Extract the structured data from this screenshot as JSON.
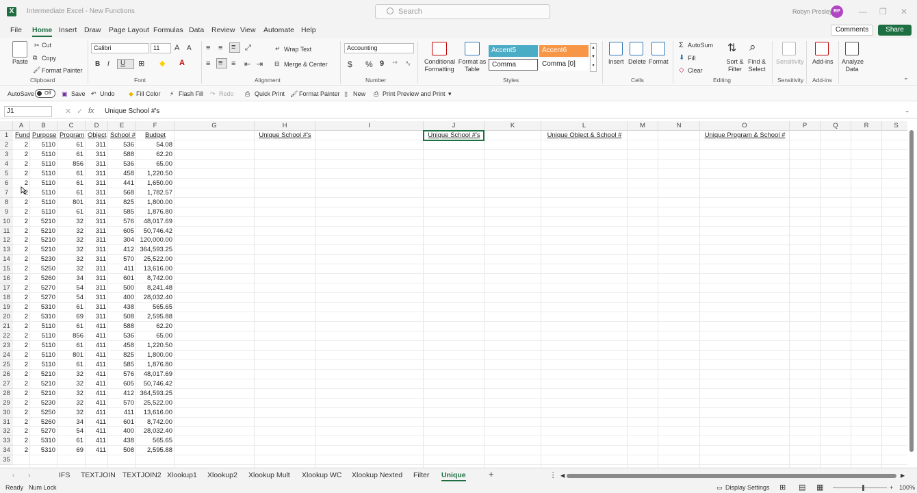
{
  "window": {
    "title": "Intermediate Excel - New Functions",
    "search_placeholder": "Search",
    "user_name": "Robyn Presley",
    "user_initials": "RP"
  },
  "menu": {
    "tabs": [
      "File",
      "Home",
      "Insert",
      "Draw",
      "Page Layout",
      "Formulas",
      "Data",
      "Review",
      "View",
      "Automate",
      "Help"
    ],
    "active": "Home",
    "comments_label": "Comments",
    "share_label": "Share"
  },
  "ribbon": {
    "clipboard": {
      "paste": "Paste",
      "cut": "Cut",
      "copy": "Copy",
      "format_painter": "Format Painter",
      "label": "Clipboard"
    },
    "font": {
      "name": "Calibri",
      "size": "11",
      "bold": "B",
      "italic": "I",
      "underline": "U",
      "label": "Font"
    },
    "alignment": {
      "wrap_text": "Wrap Text",
      "merge_center": "Merge & Center",
      "label": "Alignment"
    },
    "number": {
      "format": "Accounting",
      "currency": "$",
      "percent": "%",
      "comma": "9",
      "label": "Number"
    },
    "styles": {
      "conditional_formatting": "Conditional Formatting",
      "format_as_table": "Format as Table",
      "accent5": "Accent5",
      "accent6": "Accent6",
      "comma": "Comma",
      "comma0": "Comma [0]",
      "label": "Styles",
      "accent5_color": "#4bacc6",
      "accent6_color": "#f79646"
    },
    "cells": {
      "insert": "Insert",
      "delete": "Delete",
      "format": "Format",
      "label": "Cells"
    },
    "editing": {
      "autosum": "AutoSum",
      "fill": "Fill",
      "clear": "Clear",
      "sort_filter": "Sort & Filter",
      "find_select": "Find & Select",
      "label": "Editing"
    },
    "sensitivity": {
      "button": "Sensitivity",
      "label": "Sensitivity"
    },
    "addins": {
      "button": "Add-ins",
      "label": "Add-ins"
    },
    "analyze": {
      "button": "Analyze Data"
    }
  },
  "qat": {
    "autosave": "AutoSave",
    "autosave_state": "Off",
    "save": "Save",
    "undo": "Undo",
    "fill_color": "Fill Color",
    "flash_fill": "Flash Fill",
    "redo": "Redo",
    "quick_print": "Quick Print",
    "format_painter": "Format Painter",
    "new": "New",
    "print_preview": "Print Preview and Print"
  },
  "formula_bar": {
    "name_box": "J1",
    "fx": "fx",
    "content": "Unique School #'s"
  },
  "grid": {
    "columns": [
      "A",
      "B",
      "C",
      "D",
      "E",
      "F",
      "G",
      "H",
      "I",
      "J",
      "K",
      "L",
      "M",
      "N",
      "O",
      "P",
      "Q",
      "R",
      "S"
    ],
    "row_count": 35,
    "headers": [
      "Fund",
      "Purpose",
      "Program",
      "Object",
      "School #",
      "Budget"
    ],
    "extra_headers": {
      "H": "Unique School #'s",
      "J": "Unique School #'s",
      "L": "Unique Object & School #",
      "O": "Unique Program & School #"
    },
    "rows": [
      [
        "2",
        "5110",
        "61",
        "311",
        "536",
        "54.08"
      ],
      [
        "2",
        "5110",
        "61",
        "311",
        "588",
        "62.20"
      ],
      [
        "2",
        "5110",
        "856",
        "311",
        "536",
        "65.00"
      ],
      [
        "2",
        "5110",
        "61",
        "311",
        "458",
        "1,220.50"
      ],
      [
        "2",
        "5110",
        "61",
        "311",
        "441",
        "1,650.00"
      ],
      [
        "2",
        "5110",
        "61",
        "311",
        "568",
        "1,782.57"
      ],
      [
        "2",
        "5110",
        "801",
        "311",
        "825",
        "1,800.00"
      ],
      [
        "2",
        "5110",
        "61",
        "311",
        "585",
        "1,876.80"
      ],
      [
        "2",
        "5210",
        "32",
        "311",
        "576",
        "48,017.69"
      ],
      [
        "2",
        "5210",
        "32",
        "311",
        "605",
        "50,746.42"
      ],
      [
        "2",
        "5210",
        "32",
        "311",
        "304",
        "120,000.00"
      ],
      [
        "2",
        "5210",
        "32",
        "311",
        "412",
        "364,593.25"
      ],
      [
        "2",
        "5230",
        "32",
        "311",
        "570",
        "25,522.00"
      ],
      [
        "2",
        "5250",
        "32",
        "311",
        "411",
        "13,616.00"
      ],
      [
        "2",
        "5260",
        "34",
        "311",
        "601",
        "8,742.00"
      ],
      [
        "2",
        "5270",
        "54",
        "311",
        "500",
        "8,241.48"
      ],
      [
        "2",
        "5270",
        "54",
        "311",
        "400",
        "28,032.40"
      ],
      [
        "2",
        "5310",
        "61",
        "311",
        "438",
        "565.65"
      ],
      [
        "2",
        "5310",
        "69",
        "311",
        "508",
        "2,595.88"
      ],
      [
        "2",
        "5110",
        "61",
        "411",
        "588",
        "62.20"
      ],
      [
        "2",
        "5110",
        "856",
        "411",
        "536",
        "65.00"
      ],
      [
        "2",
        "5110",
        "61",
        "411",
        "458",
        "1,220.50"
      ],
      [
        "2",
        "5110",
        "801",
        "411",
        "825",
        "1,800.00"
      ],
      [
        "2",
        "5110",
        "61",
        "411",
        "585",
        "1,876.80"
      ],
      [
        "2",
        "5210",
        "32",
        "411",
        "576",
        "48,017.69"
      ],
      [
        "2",
        "5210",
        "32",
        "411",
        "605",
        "50,746.42"
      ],
      [
        "2",
        "5210",
        "32",
        "411",
        "412",
        "364,593.25"
      ],
      [
        "2",
        "5230",
        "32",
        "411",
        "570",
        "25,522.00"
      ],
      [
        "2",
        "5250",
        "32",
        "411",
        "411",
        "13,616.00"
      ],
      [
        "2",
        "5260",
        "34",
        "411",
        "601",
        "8,742.00"
      ],
      [
        "2",
        "5270",
        "54",
        "411",
        "400",
        "28,032.40"
      ],
      [
        "2",
        "5310",
        "61",
        "411",
        "438",
        "565.65"
      ],
      [
        "2",
        "5310",
        "69",
        "411",
        "508",
        "2,595.88"
      ]
    ]
  },
  "sheets": {
    "tabs": [
      "IFS",
      "TEXTJOIN",
      "TEXTJOIN2",
      "Xlookup1",
      "Xlookup2",
      "Xlookup Mult",
      "Xlookup WC",
      "Xlookup Nexted",
      "Filter",
      "Unique"
    ],
    "active": "Unique"
  },
  "status": {
    "ready": "Ready",
    "num_lock": "Num Lock",
    "display_settings": "Display Settings",
    "zoom": "100%"
  }
}
